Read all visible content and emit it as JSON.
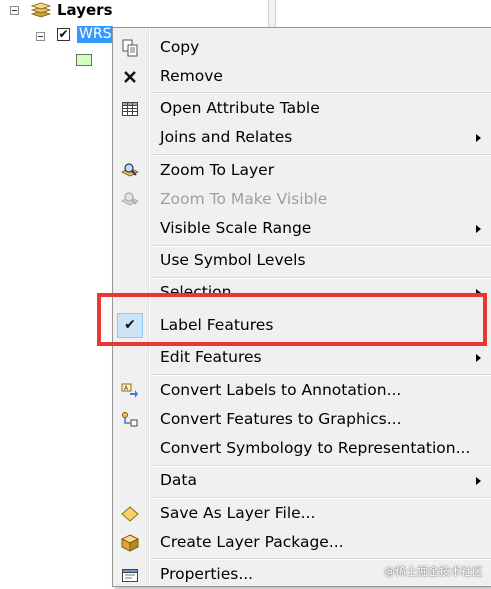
{
  "toc": {
    "root_label": "Layers",
    "layer_name": "WRS",
    "layer_checked": "✔",
    "expand_symbol": "−"
  },
  "context_menu": {
    "items": [
      {
        "label": "Copy",
        "icon": "copy-icon"
      },
      {
        "label": "Remove",
        "icon": "remove-icon"
      },
      {
        "label": "Open Attribute Table",
        "icon": "table-icon"
      },
      {
        "label": "Joins and Relates",
        "submenu": true
      },
      {
        "label": "Zoom To Layer",
        "icon": "zoom-to-layer-icon"
      },
      {
        "label": "Zoom To Make Visible",
        "icon": "zoom-visible-icon",
        "disabled": true
      },
      {
        "label": "Visible Scale Range",
        "submenu": true
      },
      {
        "label": "Use Symbol Levels"
      },
      {
        "label": "Selection",
        "submenu": true
      },
      {
        "label": "Label Features",
        "checked": true,
        "check_glyph": "✔"
      },
      {
        "label": "Edit Features",
        "submenu": true
      },
      {
        "label": "Convert Labels to Annotation...",
        "icon": "convert-labels-icon"
      },
      {
        "label": "Convert Features to Graphics...",
        "icon": "convert-features-icon"
      },
      {
        "label": "Convert Symbology to Representation..."
      },
      {
        "label": "Data",
        "submenu": true
      },
      {
        "label": "Save As Layer File...",
        "icon": "layer-file-icon"
      },
      {
        "label": "Create Layer Package...",
        "icon": "layer-package-icon"
      },
      {
        "label": "Properties...",
        "icon": "properties-icon"
      }
    ]
  },
  "watermark": "@稀土掘金技术社区",
  "colors": {
    "menu_background": "#f0f0f0",
    "selection_blue": "#3399ff",
    "highlight_red": "#e53935",
    "check_highlight": "#cce4f7"
  }
}
